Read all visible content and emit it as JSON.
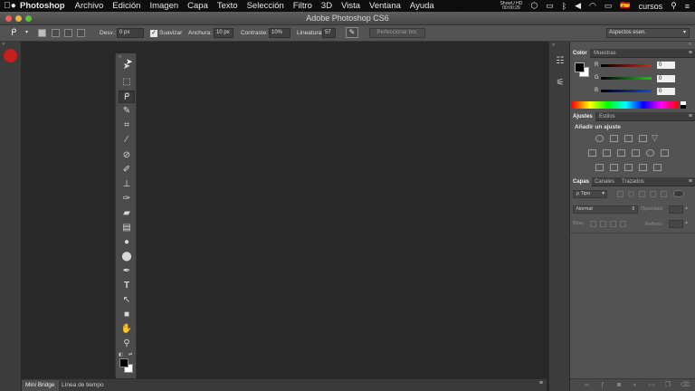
{
  "menubar": {
    "apple": "",
    "app_name": "Photoshop",
    "items": [
      "Archivo",
      "Edición",
      "Imagen",
      "Capa",
      "Texto",
      "Selección",
      "Filtro",
      "3D",
      "Vista",
      "Ventana",
      "Ayuda"
    ],
    "recorder_line1": "ShowU HD",
    "recorder_line2": "00:00:29",
    "flag": "🇪🇸",
    "user": "cursos"
  },
  "window": {
    "title": "Adobe Photoshop CS6"
  },
  "options_bar": {
    "tool_glyph": "ᑭ",
    "feather_label": "Desv.:",
    "feather_value": "0 px",
    "antialias_label": "Suavizar",
    "width_label": "Anchura:",
    "width_value": "10 px",
    "contrast_label": "Contraste:",
    "contrast_value": "10%",
    "frequency_label": "Lineatura:",
    "frequency_value": "57",
    "refine_edge": "Perfeccionar bor.",
    "workspace": "Aspectos esen."
  },
  "tools": [
    {
      "name": "move",
      "glyph": "➤"
    },
    {
      "name": "marquee",
      "glyph": "⬚"
    },
    {
      "name": "lasso",
      "glyph": "ᑭ"
    },
    {
      "name": "quick-select",
      "glyph": "✎"
    },
    {
      "name": "crop",
      "glyph": "⌗"
    },
    {
      "name": "eyedropper",
      "glyph": "⁄"
    },
    {
      "name": "healing",
      "glyph": "⊘"
    },
    {
      "name": "brush",
      "glyph": "✐"
    },
    {
      "name": "stamp",
      "glyph": "⊥"
    },
    {
      "name": "history-brush",
      "glyph": "✑"
    },
    {
      "name": "eraser",
      "glyph": "▰"
    },
    {
      "name": "gradient",
      "glyph": "▤"
    },
    {
      "name": "blur",
      "glyph": "●"
    },
    {
      "name": "dodge",
      "glyph": "⬤"
    },
    {
      "name": "pen",
      "glyph": "✒"
    },
    {
      "name": "type",
      "glyph": "T"
    },
    {
      "name": "path-select",
      "glyph": "↖"
    },
    {
      "name": "shape",
      "glyph": "■"
    },
    {
      "name": "hand",
      "glyph": "✋"
    },
    {
      "name": "zoom",
      "glyph": "⚲"
    }
  ],
  "bottom_tabs": [
    "Mini Bridge",
    "Línea de tiempo"
  ],
  "dock": {
    "collapse": "«",
    "expand": "»"
  },
  "color_panel": {
    "tabs": [
      "Color",
      "Muestras"
    ],
    "channels": [
      {
        "label": "R",
        "value": "0",
        "color": "#e02020"
      },
      {
        "label": "G",
        "value": "0",
        "color": "#20c020"
      },
      {
        "label": "B",
        "value": "0",
        "color": "#2040e0"
      }
    ]
  },
  "adjustments_panel": {
    "tabs": [
      "Ajustes",
      "Estilos"
    ],
    "heading": "Añadir un ajuste"
  },
  "layers_panel": {
    "tabs": [
      "Capas",
      "Canales",
      "Trazados"
    ],
    "kind": "ρ Tipo",
    "blend_mode": "Normal",
    "opacity_label": "Opacidad:",
    "lock_label": "Bloq.:",
    "fill_label": "Relleno:"
  },
  "colors": {
    "accent_red": "#c81e1e",
    "panel_bg": "#535353",
    "canvas_bg": "#282828"
  }
}
